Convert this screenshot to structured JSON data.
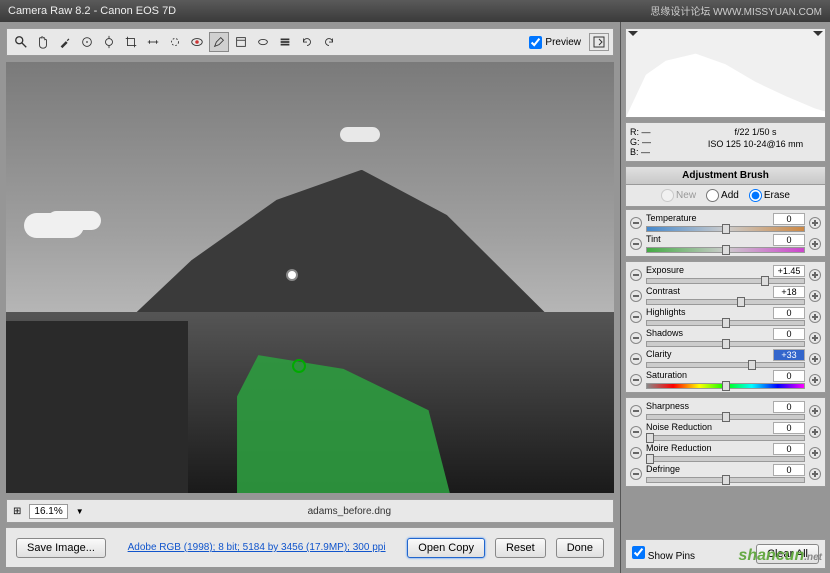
{
  "title": "Camera Raw 8.2  -  Canon EOS 7D",
  "watermark_top_left": "思缘设计论坛",
  "watermark_top_right": "WWW.MISSYUAN.COM",
  "watermark_bottom": "shancun",
  "watermark_bottom2": ".net",
  "toolbar": {
    "preview_label": "Preview",
    "preview_checked": true
  },
  "readout": {
    "r": "R:   —",
    "g": "G:   —",
    "b": "B:   —",
    "aperture_shutter": "f/22   1/50 s",
    "iso_lens": "ISO 125   10-24@16 mm"
  },
  "panel_title": "Adjustment Brush",
  "modes": {
    "new": "New",
    "add": "Add",
    "erase": "Erase",
    "selected": "erase"
  },
  "sliders": [
    [
      {
        "name": "Temperature",
        "value": "0",
        "pos": 50,
        "track": "temp"
      },
      {
        "name": "Tint",
        "value": "0",
        "pos": 50,
        "track": "tint"
      }
    ],
    [
      {
        "name": "Exposure",
        "value": "+1.45",
        "pos": 75
      },
      {
        "name": "Contrast",
        "value": "+18",
        "pos": 60
      },
      {
        "name": "Highlights",
        "value": "0",
        "pos": 50
      },
      {
        "name": "Shadows",
        "value": "0",
        "pos": 50
      },
      {
        "name": "Clarity",
        "value": "+33",
        "pos": 67,
        "active": true
      },
      {
        "name": "Saturation",
        "value": "0",
        "pos": 50,
        "track": "sat"
      }
    ],
    [
      {
        "name": "Sharpness",
        "value": "0",
        "pos": 50
      },
      {
        "name": "Noise Reduction",
        "value": "0",
        "pos": 2
      },
      {
        "name": "Moire Reduction",
        "value": "0",
        "pos": 2
      },
      {
        "name": "Defringe",
        "value": "0",
        "pos": 50
      }
    ]
  ],
  "show_pins": {
    "label": "Show Pins",
    "checked": true
  },
  "clear_all": "Clear All",
  "zoom_levels": "16.1%",
  "zoom_icon": "⊞",
  "filename": "adams_before.dng",
  "save_image": "Save Image...",
  "meta_link": "Adobe RGB (1998); 8 bit; 5184 by 3456 (17.9MP); 300 ppi",
  "open_copy": "Open Copy",
  "reset": "Reset",
  "done": "Done"
}
